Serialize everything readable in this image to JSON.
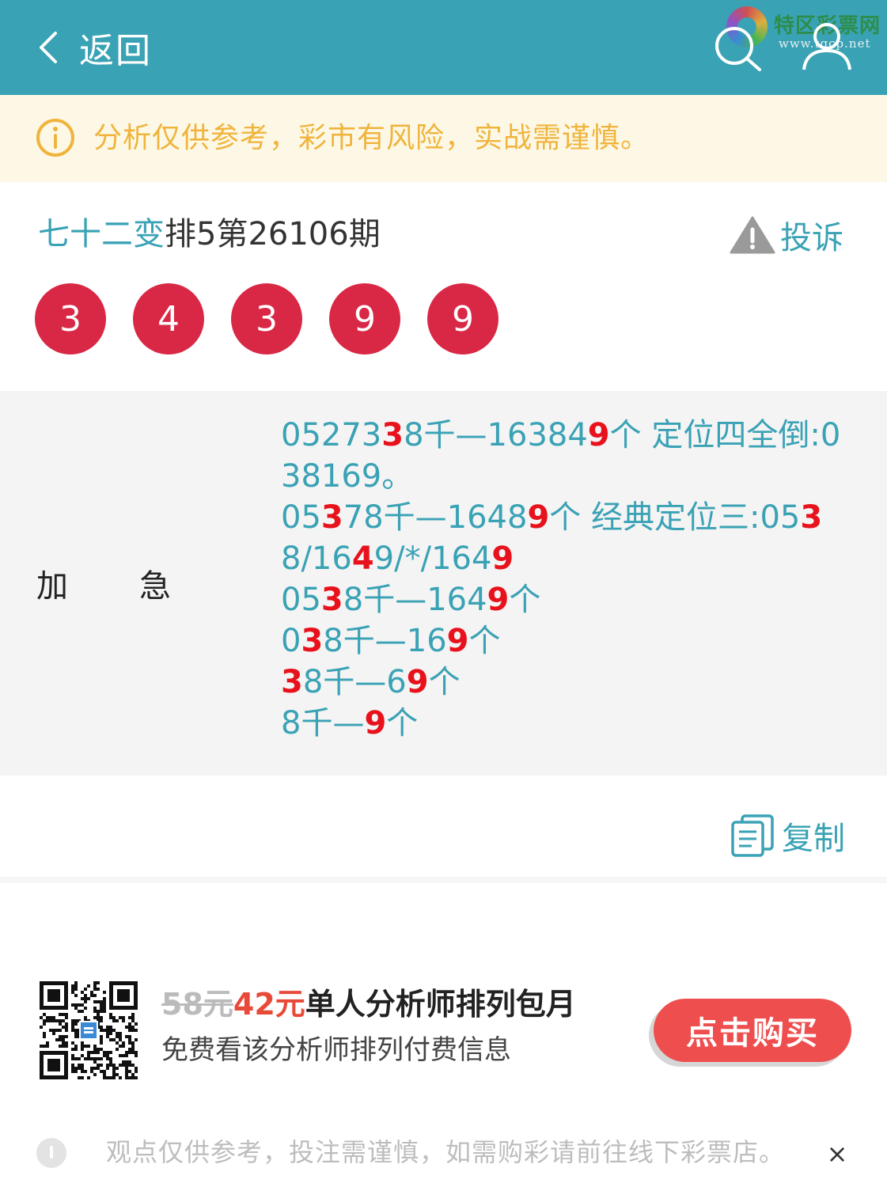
{
  "header": {
    "back_label": "返回",
    "logo_title": "特区彩票网",
    "logo_sub": "www.tqcp.net",
    "icons": [
      "chevron-left-icon",
      "search-icon",
      "user-icon"
    ],
    "bg_color": "#3aa2b5"
  },
  "notice": {
    "text": "分析仅供参考，彩市有风险，实战需谨慎。",
    "icon": "info-icon",
    "color": "#f0b43c"
  },
  "article": {
    "analyst": "七十二变",
    "issue": "排5第26106期",
    "complain_label": "投诉",
    "balls": [
      "3",
      "4",
      "3",
      "9",
      "9"
    ],
    "ball_color": "#d92845"
  },
  "content": {
    "label_1": "加",
    "label_2": "急",
    "lines": [
      [
        {
          "t": "05273"
        },
        {
          "t": "3",
          "hl": true
        },
        {
          "t": "8千—16384"
        },
        {
          "t": "9",
          "hl": true
        },
        {
          "t": "个 定位四全倒:0"
        }
      ],
      [
        {
          "t": "38169。"
        }
      ],
      [
        {
          "t": "05"
        },
        {
          "t": "3",
          "hl": true
        },
        {
          "t": "78千—1648"
        },
        {
          "t": "9",
          "hl": true
        },
        {
          "t": "个 经典定位三:05"
        },
        {
          "t": "3",
          "hl": true
        }
      ],
      [
        {
          "t": "8/16"
        },
        {
          "t": "4",
          "hl": true
        },
        {
          "t": "9/*/164"
        },
        {
          "t": "9",
          "hl": true
        }
      ],
      [
        {
          "t": "05"
        },
        {
          "t": "3",
          "hl": true
        },
        {
          "t": "8千—164"
        },
        {
          "t": "9",
          "hl": true
        },
        {
          "t": "个"
        }
      ],
      [
        {
          "t": "0"
        },
        {
          "t": "3",
          "hl": true
        },
        {
          "t": "8千—16"
        },
        {
          "t": "9",
          "hl": true
        },
        {
          "t": "个"
        }
      ],
      [
        {
          "t": "3",
          "hl": true
        },
        {
          "t": "8千—6"
        },
        {
          "t": "9",
          "hl": true
        },
        {
          "t": "个"
        }
      ],
      [
        {
          "t": "8千—"
        },
        {
          "t": "9",
          "hl": true
        },
        {
          "t": "个"
        }
      ]
    ],
    "text_color": "#3aa2b5",
    "highlight_color": "#e8121c"
  },
  "copy": {
    "label": "复制"
  },
  "promo": {
    "price_old": "58元",
    "price_new": "42元",
    "title": "单人分析师排列包月",
    "desc": "免费看该分析师排列付费信息",
    "buy_label": "点击购买",
    "buy_color": "#ee4e4e"
  },
  "bottom": {
    "text": "观点仅供参考，投注需谨慎，如需购彩请前往线下彩票店。",
    "close": "×"
  }
}
